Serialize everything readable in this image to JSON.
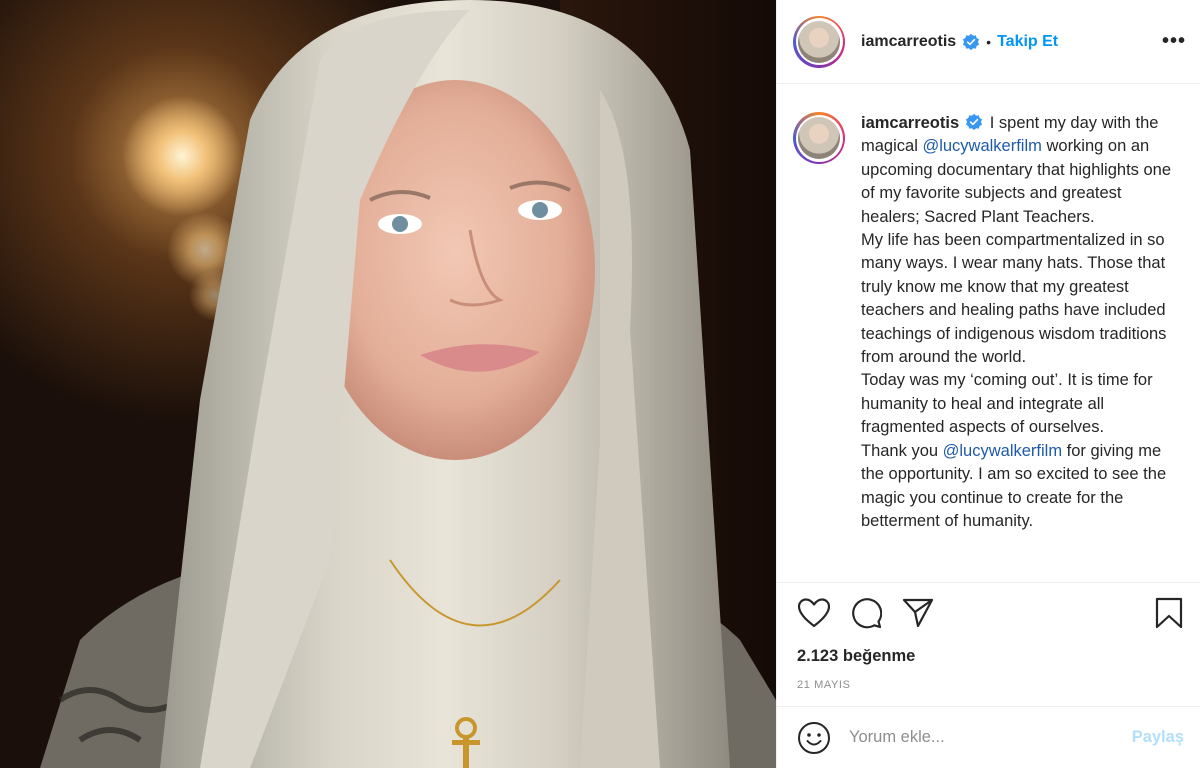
{
  "post": {
    "username": "iamcarreotis",
    "follow_label": "Takip Et",
    "separator": "•",
    "more_label": "•••"
  },
  "caption": {
    "username": "iamcarreotis",
    "part1": " I spent my day with the magical ",
    "mention1": "@lucywalkerfilm",
    "part2": " working on an upcoming documentary that highlights one of my favorite subjects and greatest healers; Sacred Plant Teachers.\nMy life has been compartmentalized in so many ways. I wear many hats. Those that truly know me know that my greatest teachers and healing paths have included teachings of indigenous wisdom traditions from around the world.\nToday was my ‘coming out’. It is time for humanity to heal and integrate all fragmented aspects of ourselves.\nThank you ",
    "mention2": "@lucywalkerfilm",
    "part3": " for giving me the opportunity. I am so excited to see the magic you continue to create for the betterment of humanity."
  },
  "stats": {
    "likes": "2.123 beğenme",
    "date": "21 MAYIS"
  },
  "comment": {
    "placeholder": "Yorum ekle...",
    "post_label": "Paylaş"
  },
  "icons": {
    "verified": "verified-badge-icon",
    "like": "heart-icon",
    "comment": "comment-icon",
    "share": "share-icon",
    "save": "bookmark-icon",
    "emoji": "emoji-icon"
  },
  "colors": {
    "accent": "#0095f6",
    "mention": "#1e5aa8",
    "muted": "#8e8e8e",
    "post_disabled": "#b2dffc"
  }
}
